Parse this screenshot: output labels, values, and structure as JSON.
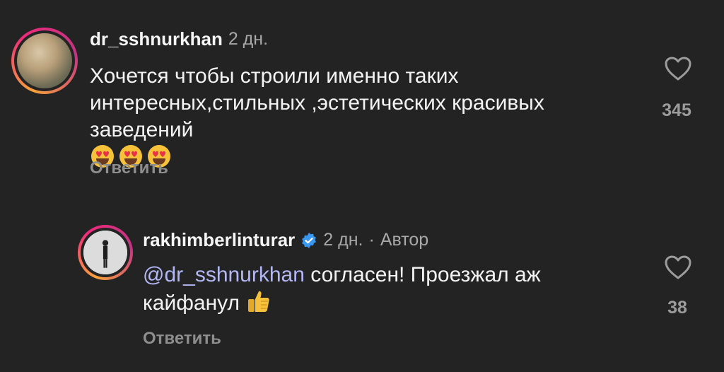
{
  "comments": [
    {
      "username": "dr_sshnurkhan",
      "time": "2 дн.",
      "text": "Хочется чтобы строили именно таких интересных,стильных ,эстетических красивых заведений",
      "emojis": [
        "heart-eyes-icon",
        "heart-eyes-icon",
        "heart-eyes-icon"
      ],
      "reply_label": "Ответить",
      "likes": "345"
    },
    {
      "username": "rakhimberlinturar",
      "time": "2 дн.",
      "separator": "·",
      "author_badge": "Автор",
      "mention": "@dr_sshnurkhan",
      "text": "согласен! Проезжал аж кайфанул",
      "emojis": [
        "thumbs-up-icon"
      ],
      "reply_label": "Ответить",
      "likes": "38"
    }
  ],
  "colors": {
    "background": "#232323",
    "mention": "#b3b8f5",
    "verified": "#3897f0",
    "muted": "#8e8e8e"
  }
}
